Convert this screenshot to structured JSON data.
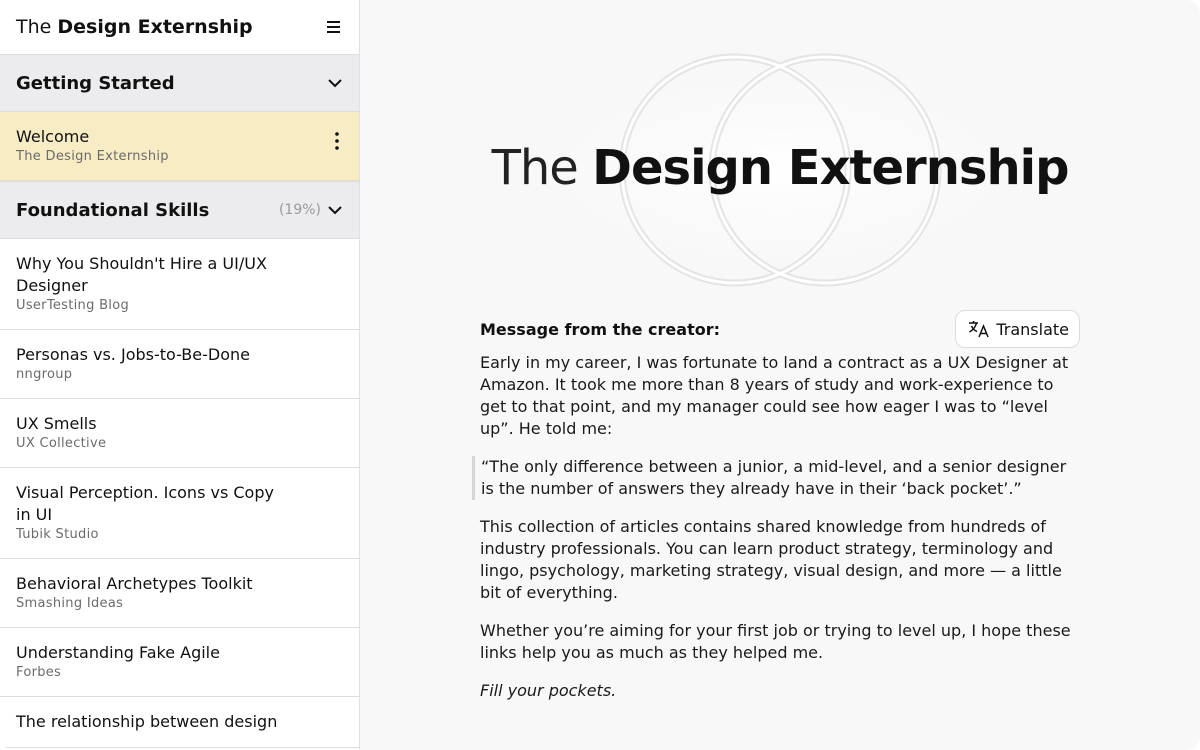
{
  "sidebar": {
    "brand_prefix": "The",
    "brand_bold": "Design Externship",
    "menu_icon": "hamburger-icon",
    "sections": [
      {
        "title": "Getting Started",
        "percent": ""
      },
      {
        "title": "Foundational Skills",
        "percent": "(19%)"
      }
    ],
    "welcome": {
      "title": "Welcome",
      "subtitle": "The Design Externship"
    },
    "items": [
      {
        "title": "Why You Shouldn't Hire a UI/UX Designer",
        "subtitle": "UserTesting Blog"
      },
      {
        "title": "Personas vs. Jobs-to-Be-Done",
        "subtitle": "nngroup"
      },
      {
        "title": "UX Smells",
        "subtitle": "UX Collective"
      },
      {
        "title": "Visual Perception. Icons vs Copy in UI",
        "subtitle": "Tubik Studio"
      },
      {
        "title": "Behavioral Archetypes Toolkit",
        "subtitle": "Smashing Ideas"
      },
      {
        "title": "Understanding Fake Agile",
        "subtitle": "Forbes"
      },
      {
        "title": "The relationship between design",
        "subtitle": ""
      }
    ],
    "active_highlight": "#f7ecc4"
  },
  "main": {
    "hero_prefix": "The",
    "hero_bold": "Design Externship",
    "message_label": "Message from the creator:",
    "translate_label": "Translate",
    "translate_icon": "translate-icon",
    "para1": "Early in my career, I was fortunate to land a contract as a UX Designer at Amazon. It took me more than 8 years of study and work-experience to get to that point, and my manager could see how eager I was to “level up”. He told me:",
    "quote": "“The only difference between a junior, a mid-level, and a senior designer is the number of answers they already have in their ‘back pocket’.”",
    "para2": "This collection of articles contains shared knowledge from hundreds of industry professionals. You can learn product strategy, terminology and lingo, psychology, marketing strategy, visual design, and more — a little bit of everything.",
    "para3": "Whether you’re aiming for your first job or trying to level up, I hope these links help you as much as they helped me.",
    "signoff": "Fill your pockets."
  }
}
